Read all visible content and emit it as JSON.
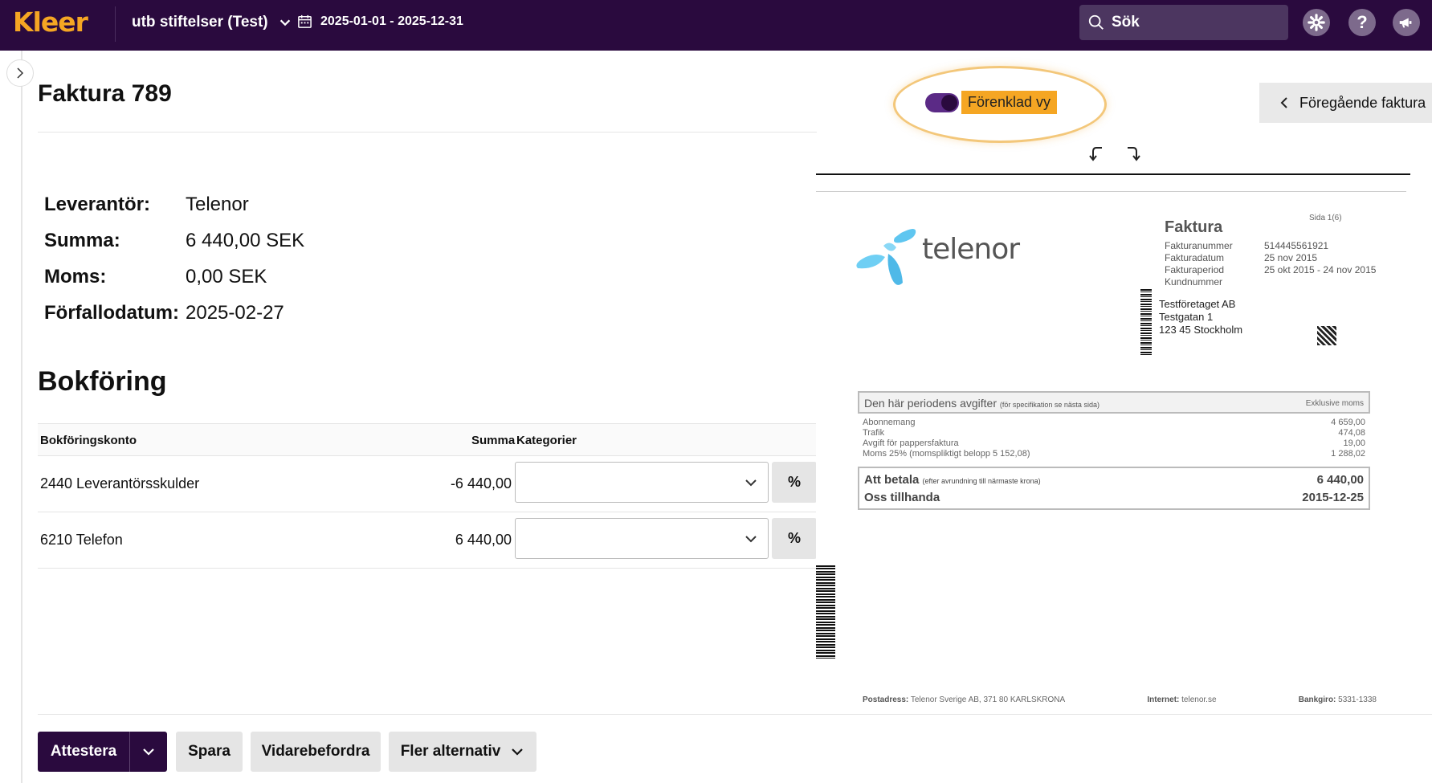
{
  "header": {
    "logo": "Kleer",
    "organization": "utb stiftelser (Test)",
    "date_range": "2025-01-01 - 2025-12-31",
    "search_placeholder": "Sök",
    "help_label": "?"
  },
  "invoice": {
    "title": "Faktura 789",
    "simplified_view_label": "Förenklad vy",
    "simplified_view_on": true,
    "previous_invoice_label": "Föregående faktura",
    "details": [
      {
        "label": "Leverantör:",
        "value": "Telenor"
      },
      {
        "label": "Summa:",
        "value": "6 440,00 SEK"
      },
      {
        "label": "Moms:",
        "value": "0,00 SEK"
      },
      {
        "label": "Förfallodatum:",
        "value": "2025-02-27"
      }
    ]
  },
  "bookkeeping": {
    "title": "Bokföring",
    "headers": {
      "account": "Bokföringskonto",
      "sum": "Summa",
      "categories": "Kategorier"
    },
    "rows": [
      {
        "account": "2440 Leverantörsskulder",
        "sum": "-6 440,00",
        "category": "",
        "pct_label": "%"
      },
      {
        "account": "6210 Telefon",
        "sum": "6 440,00",
        "category": "",
        "pct_label": "%"
      }
    ]
  },
  "document": {
    "brand": "telenor",
    "title": "Faktura",
    "page": "Sida 1(6)",
    "meta": [
      {
        "k": "Fakturanummer",
        "v": "514445561921"
      },
      {
        "k": "Fakturadatum",
        "v": "25 nov 2015"
      },
      {
        "k": "Fakturaperiod",
        "v": "25 okt 2015 - 24 nov 2015"
      },
      {
        "k": "Kundnummer",
        "v": ""
      }
    ],
    "address": [
      "Testföretaget AB",
      "Testgatan 1",
      "123 45 Stockholm"
    ],
    "charges_title": "Den här periodens avgifter",
    "charges_note": "(för specifikation se nästa sida)",
    "charges_right": "Exklusive moms",
    "charges": [
      {
        "k": "Abonnemang",
        "v": "4 659,00"
      },
      {
        "k": "Trafik",
        "v": "474,08"
      },
      {
        "k": "Avgift för pappersfaktura",
        "v": "19,00"
      },
      {
        "k": "Moms 25% (momspliktigt belopp 5 152,08)",
        "v": "1 288,02"
      }
    ],
    "to_pay_label": "Att betala",
    "to_pay_note": "(efter avrundning till närmaste krona)",
    "to_pay_value": "6 440,00",
    "due_label": "Oss tillhanda",
    "due_value": "2015-12-25",
    "footer": [
      {
        "k": "Postadress:",
        "v": "Telenor Sverige AB, 371 80 KARLSKRONA"
      },
      {
        "k": "Internet:",
        "v": "telenor.se"
      },
      {
        "k": "Bankgiro:",
        "v": "5331-1338"
      }
    ]
  },
  "actions": {
    "approve": "Attestera",
    "save": "Spara",
    "forward": "Vidarebefordra",
    "more": "Fler alternativ"
  },
  "colors": {
    "brand_dark": "#2a0a3e",
    "accent": "#f5a623"
  }
}
